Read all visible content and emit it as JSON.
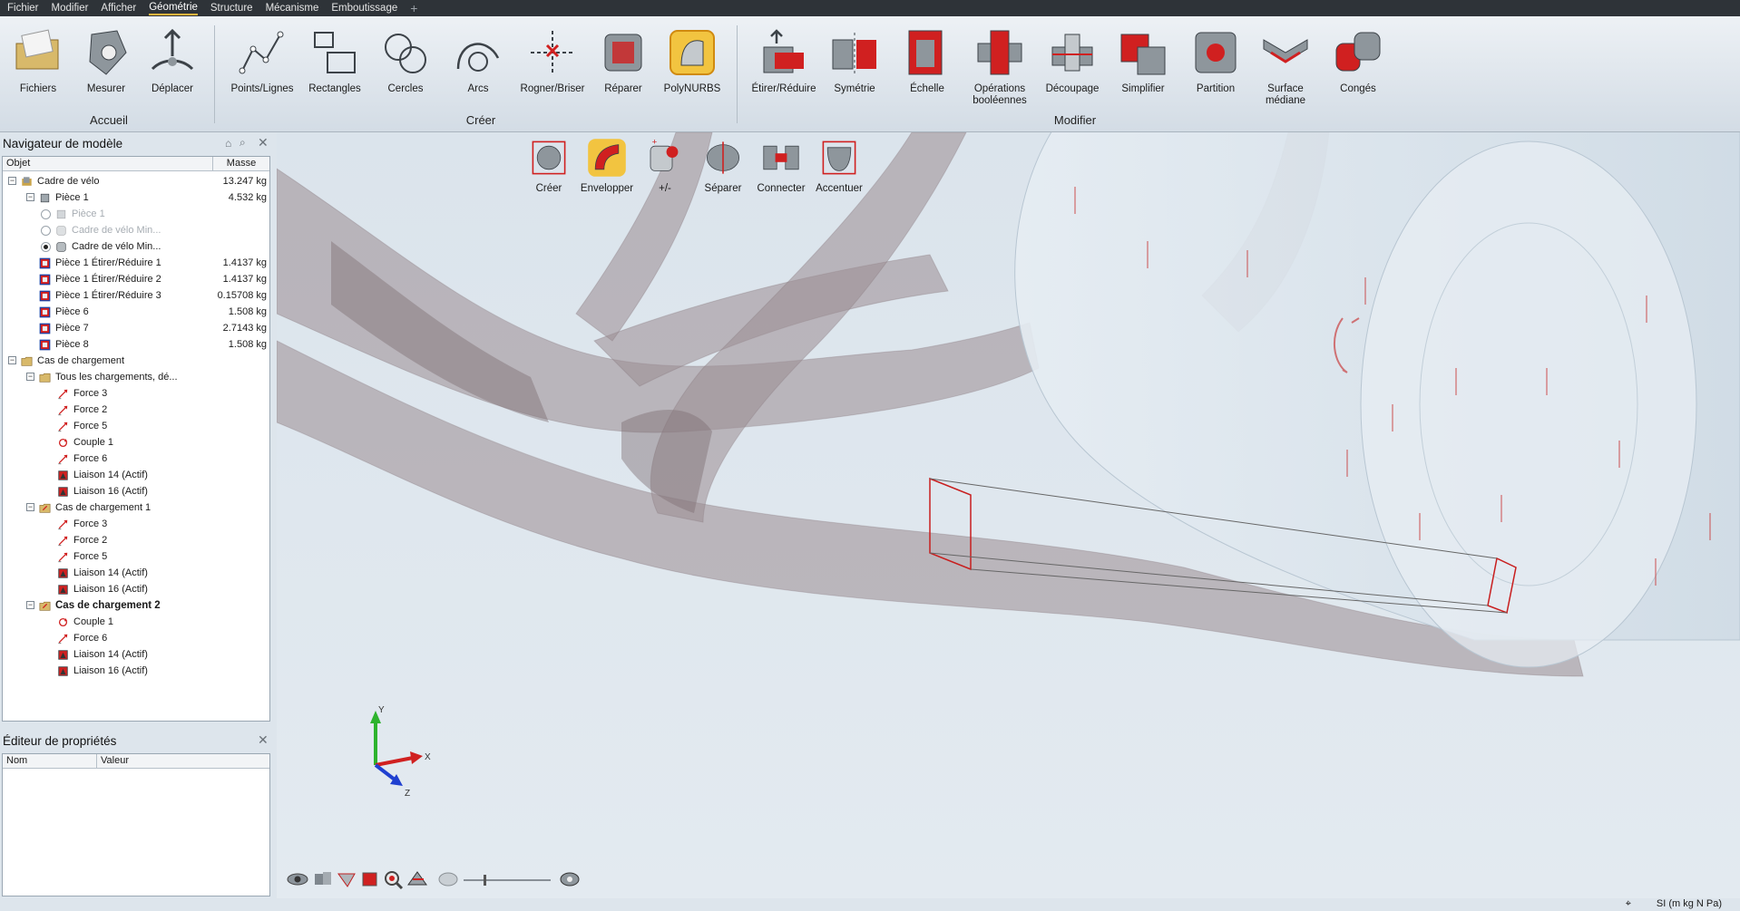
{
  "menu": {
    "tabs": [
      "Fichier",
      "Modifier",
      "Afficher",
      "Géométrie",
      "Structure",
      "Mécanisme",
      "Emboutissage"
    ],
    "active": "Géométrie",
    "add": "+"
  },
  "ribbon": {
    "groups": {
      "accueil": "Accueil",
      "creer": "Créer",
      "modifier": "Modifier"
    },
    "accueil_tools": [
      "Fichiers",
      "Mesurer",
      "Déplacer"
    ],
    "creer_tools": [
      "Points/Lignes",
      "Rectangles",
      "Cercles",
      "Arcs",
      "Rogner/Briser",
      "Réparer",
      "PolyNURBS"
    ],
    "modifier_tools": [
      "Étirer/Réduire",
      "Symétrie",
      "Échelle",
      "Opérations booléennes",
      "Découpage",
      "Simplifier",
      "Partition",
      "Surface médiane",
      "Congés"
    ]
  },
  "floating_toolbar": [
    "Créer",
    "Envelopper",
    "+/-",
    "Séparer",
    "Connecter",
    "Accentuer"
  ],
  "model_navigator": {
    "title": "Navigateur de modèle",
    "col_object": "Objet",
    "col_mass": "Masse",
    "rows": [
      {
        "label": "Cadre de vélo",
        "mass": "13.247 kg",
        "depth": 0,
        "exp": "−",
        "icon": "assembly-icon",
        "bold": false
      },
      {
        "label": "Pièce 1",
        "mass": "4.532 kg",
        "depth": 1,
        "exp": "−",
        "icon": "part-icon"
      },
      {
        "label": "Pièce 1",
        "mass": "",
        "depth": 2,
        "radio": "off",
        "dim": true,
        "icon": "part-icon"
      },
      {
        "label": "Cadre de vélo Min...",
        "mass": "",
        "depth": 2,
        "radio": "off",
        "dim": true,
        "icon": "polynurbs-icon"
      },
      {
        "label": "Cadre de vélo Min...",
        "mass": "",
        "depth": 2,
        "radio": "on",
        "icon": "polynurbs-icon"
      },
      {
        "label": "Pièce 1 Étirer/Réduire 1",
        "mass": "1.4137 kg",
        "depth": 1,
        "icon": "red-part-icon"
      },
      {
        "label": "Pièce 1 Étirer/Réduire 2",
        "mass": "1.4137 kg",
        "depth": 1,
        "icon": "red-part-icon"
      },
      {
        "label": "Pièce 1 Étirer/Réduire 3",
        "mass": "0.15708 kg",
        "depth": 1,
        "icon": "red-part-icon"
      },
      {
        "label": "Pièce 6",
        "mass": "1.508 kg",
        "depth": 1,
        "icon": "red-part-icon"
      },
      {
        "label": "Pièce 7",
        "mass": "2.7143 kg",
        "depth": 1,
        "icon": "red-part-icon"
      },
      {
        "label": "Pièce 8",
        "mass": "1.508 kg",
        "depth": 1,
        "icon": "red-part-icon"
      },
      {
        "label": "Cas de chargement",
        "mass": "",
        "depth": 0,
        "exp": "−",
        "icon": "folder-icon"
      },
      {
        "label": "Tous les chargements, dé...",
        "mass": "",
        "depth": 1,
        "exp": "−",
        "icon": "folder-icon"
      },
      {
        "label": "Force 3",
        "mass": "",
        "depth": 2,
        "icon": "force-icon"
      },
      {
        "label": "Force 2",
        "mass": "",
        "depth": 2,
        "icon": "force-icon"
      },
      {
        "label": "Force 5",
        "mass": "",
        "depth": 2,
        "icon": "force-icon"
      },
      {
        "label": "Couple 1",
        "mass": "",
        "depth": 2,
        "icon": "torque-icon"
      },
      {
        "label": "Force 6",
        "mass": "",
        "depth": 2,
        "icon": "force-icon"
      },
      {
        "label": "Liaison 14 (Actif)",
        "mass": "",
        "depth": 2,
        "icon": "support-icon"
      },
      {
        "label": "Liaison 16 (Actif)",
        "mass": "",
        "depth": 2,
        "icon": "support-icon"
      },
      {
        "label": "Cas de chargement 1",
        "mass": "",
        "depth": 1,
        "exp": "−",
        "icon": "loadcase-icon"
      },
      {
        "label": "Force 3",
        "mass": "",
        "depth": 2,
        "icon": "force-icon"
      },
      {
        "label": "Force 2",
        "mass": "",
        "depth": 2,
        "icon": "force-icon"
      },
      {
        "label": "Force 5",
        "mass": "",
        "depth": 2,
        "icon": "force-icon"
      },
      {
        "label": "Liaison 14 (Actif)",
        "mass": "",
        "depth": 2,
        "icon": "support-icon"
      },
      {
        "label": "Liaison 16 (Actif)",
        "mass": "",
        "depth": 2,
        "icon": "support-icon"
      },
      {
        "label": "Cas de chargement 2",
        "mass": "",
        "depth": 1,
        "exp": "−",
        "icon": "loadcase-icon",
        "bold": true
      },
      {
        "label": "Couple 1",
        "mass": "",
        "depth": 2,
        "icon": "torque-icon"
      },
      {
        "label": "Force 6",
        "mass": "",
        "depth": 2,
        "icon": "force-icon"
      },
      {
        "label": "Liaison 14 (Actif)",
        "mass": "",
        "depth": 2,
        "icon": "support-icon"
      },
      {
        "label": "Liaison 16 (Actif)",
        "mass": "",
        "depth": 2,
        "icon": "support-icon"
      }
    ]
  },
  "property_editor": {
    "title": "Éditeur de propriétés",
    "col_name": "Nom",
    "col_value": "Valeur"
  },
  "axes": {
    "x": "X",
    "y": "Y",
    "z": "Z"
  },
  "status": {
    "units": "SI (m kg N Pa)"
  },
  "colors": {
    "accent": "#f0b43c",
    "model_red": "#d02020",
    "part_gray": "#9e9095"
  }
}
